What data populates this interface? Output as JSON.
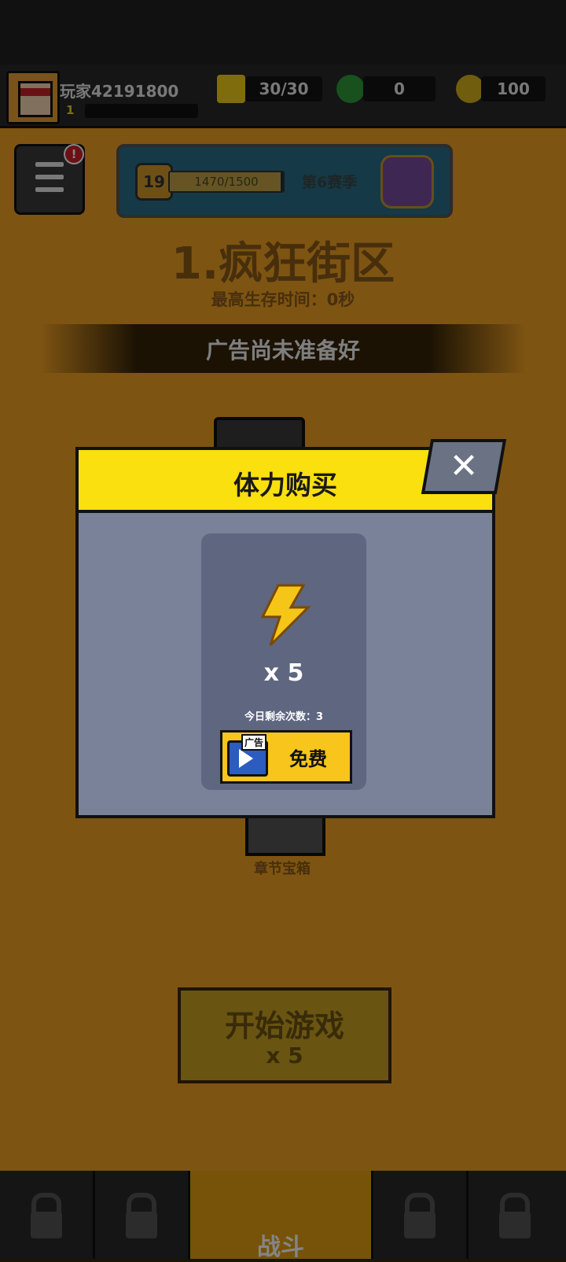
{
  "header": {
    "player_name": "玩家42191800",
    "player_level": "1",
    "energy": "30/30",
    "gems": "0",
    "coins": "100"
  },
  "menu": {
    "badge": "!"
  },
  "season": {
    "level": "19",
    "progress_text": "1470/1500",
    "progress_fraction": 0.98,
    "name": "第6赛季"
  },
  "stage": {
    "title": "1.疯狂街区",
    "best_time": "最高生存时间：0秒"
  },
  "toast": {
    "message": "广告尚未准备好"
  },
  "chest": {
    "label": "章节宝箱"
  },
  "start": {
    "label": "开始游戏",
    "cost": "x 5"
  },
  "nav": {
    "battle_label": "战斗"
  },
  "dialog": {
    "title": "体力购买",
    "close_symbol": "✕",
    "amount": "x 5",
    "remaining": "今日剩余次数：3",
    "ad_tag": "广告",
    "free_label": "免费"
  },
  "colors": {
    "accent_yellow": "#f9e00e",
    "dialog_bg": "#7a8299",
    "card_bg": "#5e6680",
    "button_yellow": "#f7c51b"
  }
}
